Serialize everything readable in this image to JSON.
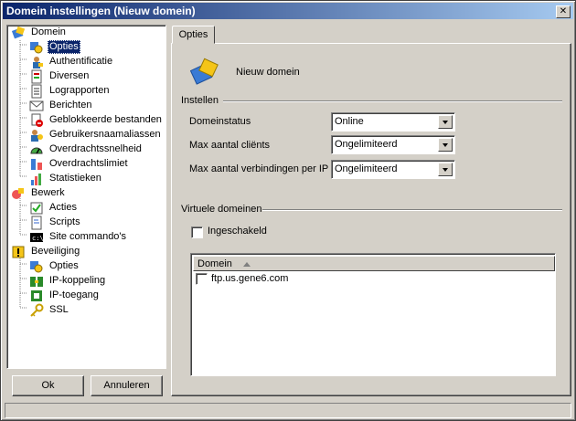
{
  "window": {
    "title": "Domein instellingen (Nieuw domein)"
  },
  "tree": {
    "items": [
      {
        "label": "Domein",
        "icon": "domain-icon",
        "level": 0
      },
      {
        "label": "Opties",
        "icon": "options-icon",
        "level": 1,
        "selected": true
      },
      {
        "label": "Authentificatie",
        "icon": "authentication-icon",
        "level": 1
      },
      {
        "label": "Diversen",
        "icon": "misc-icon",
        "level": 1
      },
      {
        "label": "Lograpporten",
        "icon": "log-icon",
        "level": 1
      },
      {
        "label": "Berichten",
        "icon": "messages-icon",
        "level": 1
      },
      {
        "label": "Geblokkeerde bestanden",
        "icon": "blocked-files-icon",
        "level": 1
      },
      {
        "label": "Gebruikersnaamaliassen",
        "icon": "user-alias-icon",
        "level": 1
      },
      {
        "label": "Overdrachtssnelheid",
        "icon": "speed-gauge-icon",
        "level": 1
      },
      {
        "label": "Overdrachtslimiet",
        "icon": "transfer-limit-icon",
        "level": 1
      },
      {
        "label": "Statistieken",
        "icon": "statistics-icon",
        "level": 1
      },
      {
        "label": "Bewerk",
        "icon": "edit-icon",
        "level": 0
      },
      {
        "label": "Acties",
        "icon": "actions-icon",
        "level": 1
      },
      {
        "label": "Scripts",
        "icon": "scripts-icon",
        "level": 1
      },
      {
        "label": "Site commando's",
        "icon": "console-icon",
        "level": 1
      },
      {
        "label": "Beveiliging",
        "icon": "security-icon",
        "level": 0
      },
      {
        "label": "Opties",
        "icon": "options-icon",
        "level": 1
      },
      {
        "label": "IP-koppeling",
        "icon": "ip-binding-icon",
        "level": 1
      },
      {
        "label": "IP-toegang",
        "icon": "ip-access-icon",
        "level": 1
      },
      {
        "label": "SSL",
        "icon": "key-icon",
        "level": 1
      }
    ]
  },
  "buttons": {
    "ok": "Ok",
    "cancel": "Annuleren"
  },
  "tab": {
    "label": "Opties"
  },
  "header": {
    "domain_name": "Nieuw domein"
  },
  "instellen": {
    "group_label": "Instellen",
    "fields": [
      {
        "label": "Domeinstatus",
        "value": "Online"
      },
      {
        "label": "Max aantal cliënts",
        "value": "Ongelimiteerd"
      },
      {
        "label": "Max aantal verbindingen per IP",
        "value": "Ongelimiteerd"
      }
    ]
  },
  "virtual": {
    "group_label": "Virtuele domeinen",
    "enabled_label": "Ingeschakeld",
    "enabled": false,
    "column_header": "Domein",
    "rows": [
      {
        "domain": "ftp.us.gene6.com",
        "checked": false
      }
    ]
  },
  "colors": {
    "titlebar_start": "#0a246a",
    "titlebar_end": "#a6caf0",
    "selection": "#0a246a",
    "face": "#d4d0c8"
  }
}
